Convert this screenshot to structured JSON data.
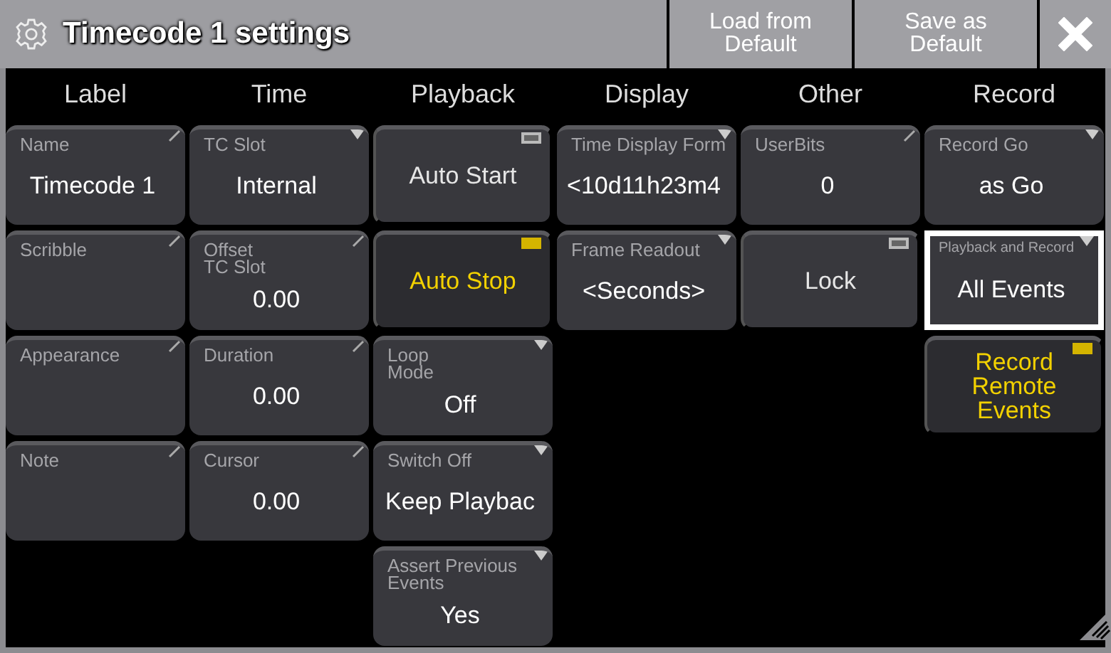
{
  "window": {
    "title": "Timecode 1 settings"
  },
  "title_buttons": [
    {
      "kind": "text",
      "label": "Load from\nDefault"
    },
    {
      "kind": "text",
      "label": "Save as\nDefault"
    },
    {
      "kind": "close"
    }
  ],
  "columns": [
    {
      "heading": "Label",
      "cells": [
        {
          "kind": "value",
          "label": "Name",
          "value": "Timecode 1",
          "editable": true,
          "dropdown": false,
          "focused": false
        },
        {
          "kind": "value",
          "label": "Scribble",
          "editable": true,
          "dropdown": false,
          "focused": false
        },
        {
          "kind": "value",
          "label": "Appearance",
          "editable": true,
          "dropdown": false,
          "focused": false
        },
        {
          "kind": "value",
          "label": "Note",
          "editable": true,
          "dropdown": false,
          "focused": false
        }
      ]
    },
    {
      "heading": "Time",
      "cells": [
        {
          "kind": "value",
          "label": "TC Slot",
          "value": "Internal",
          "editable": false,
          "dropdown": true,
          "focused": false
        },
        {
          "kind": "value",
          "label": "Offset\nTC Slot",
          "value": "0.00",
          "editable": true,
          "dropdown": false,
          "focused": false
        },
        {
          "kind": "value",
          "label": "Duration",
          "value": "0.00",
          "editable": true,
          "dropdown": false,
          "focused": false
        },
        {
          "kind": "value",
          "label": "Cursor",
          "value": "0.00",
          "editable": true,
          "dropdown": false,
          "focused": false
        }
      ]
    },
    {
      "heading": "Playback",
      "cells": [
        {
          "kind": "toggle",
          "label": "Auto Start",
          "on": false
        },
        {
          "kind": "toggle",
          "label": "Auto Stop",
          "on": true
        },
        {
          "kind": "value",
          "label": "Loop\nMode",
          "value": "Off",
          "editable": false,
          "dropdown": true,
          "focused": false
        },
        {
          "kind": "value",
          "label": "Switch Off",
          "value": "Keep Playbac",
          "editable": false,
          "dropdown": true,
          "focused": false
        },
        {
          "kind": "value",
          "label": "Assert Previous\nEvents",
          "value": "Yes",
          "editable": false,
          "dropdown": true,
          "focused": false
        }
      ]
    },
    {
      "heading": "Display",
      "cells": [
        {
          "kind": "value",
          "label": "Time Display Form",
          "value": "<10d11h23m4",
          "editable": false,
          "dropdown": true,
          "focused": false
        },
        {
          "kind": "value",
          "label": "Frame Readout",
          "value": "<Seconds>",
          "editable": false,
          "dropdown": true,
          "focused": false
        }
      ]
    },
    {
      "heading": "Other",
      "cells": [
        {
          "kind": "value",
          "label": "UserBits",
          "value": "0",
          "editable": true,
          "dropdown": false,
          "focused": false
        },
        {
          "kind": "toggle",
          "label": "Lock",
          "on": false
        }
      ]
    },
    {
      "heading": "Record",
      "cells": [
        {
          "kind": "value",
          "label": "Record Go",
          "value": "as Go",
          "editable": false,
          "dropdown": true,
          "focused": false
        },
        {
          "kind": "value",
          "label": "Playback and Record",
          "value": "All Events",
          "editable": false,
          "dropdown": true,
          "focused": true
        },
        {
          "kind": "toggle",
          "label": "Record\nRemote\nEvents",
          "on": true
        }
      ]
    }
  ]
}
